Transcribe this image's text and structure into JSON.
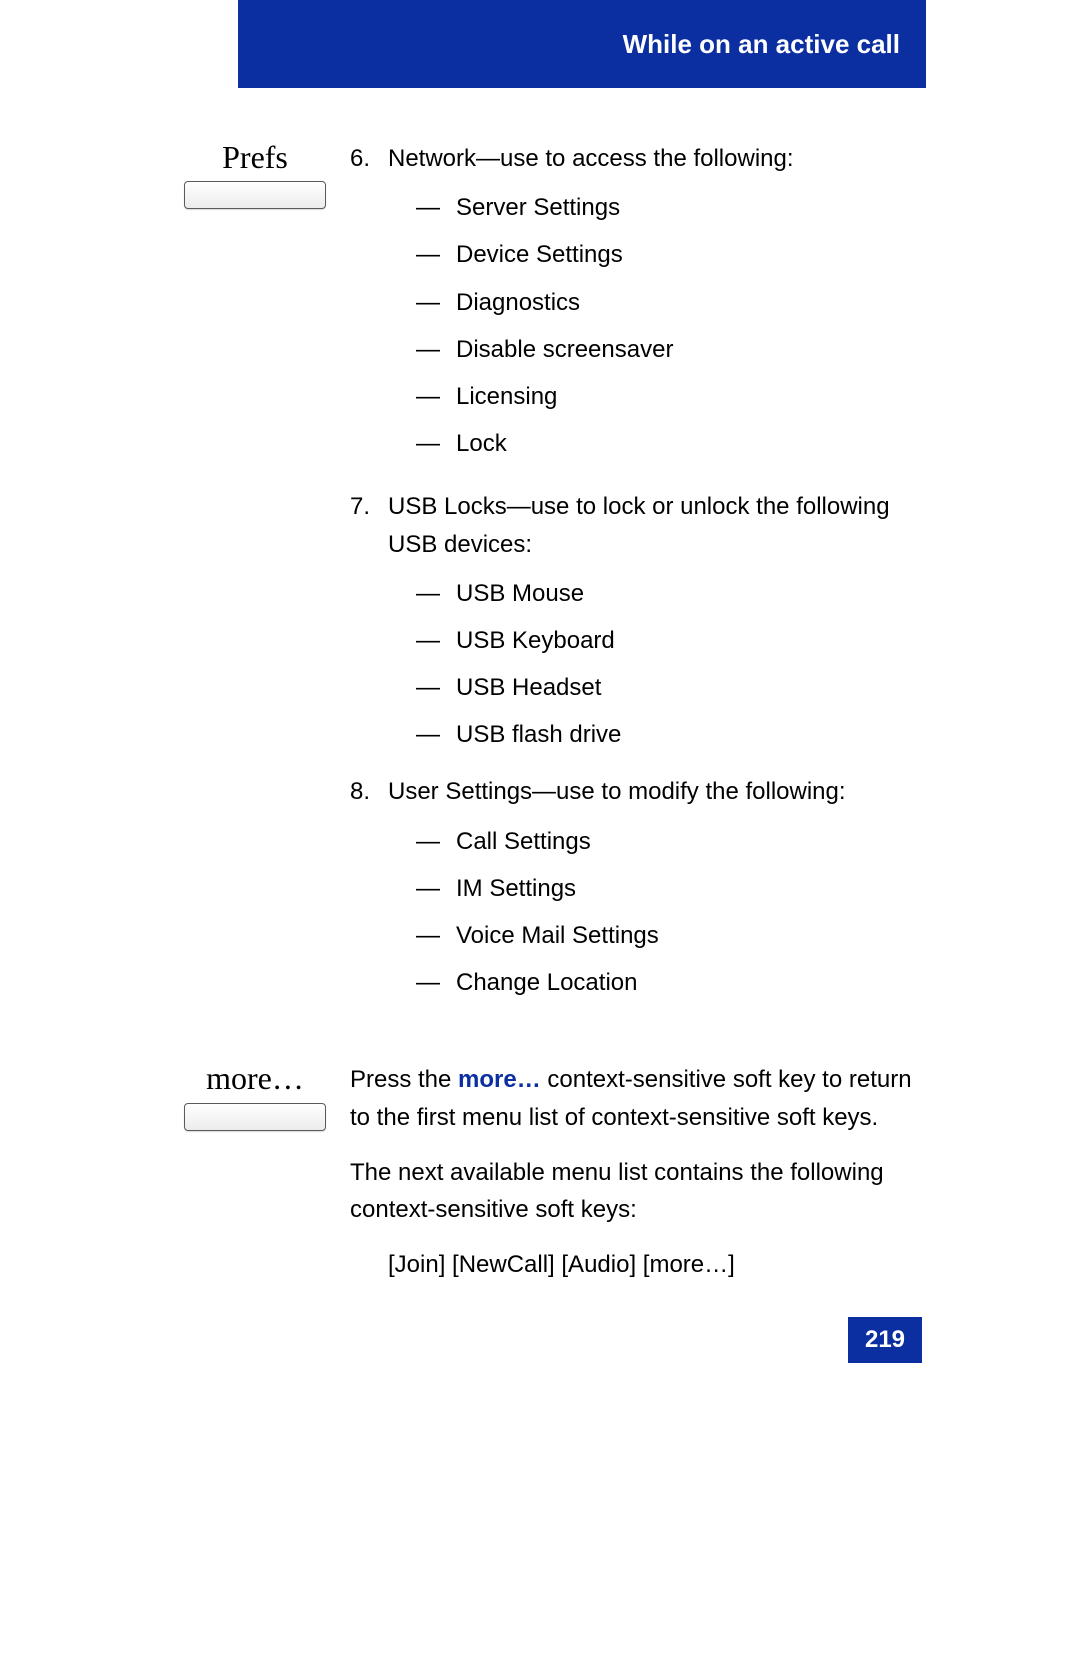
{
  "header": {
    "title": "While on an active call"
  },
  "softkeys": {
    "prefs": "Prefs",
    "more": "more…"
  },
  "item6": {
    "num": "6.",
    "text": "Network—use to access the following:",
    "sub": [
      "Server Settings",
      "Device Settings",
      "Diagnostics",
      "Disable screensaver",
      "Licensing",
      "Lock"
    ]
  },
  "item7": {
    "num": "7.",
    "text": "USB Locks—use to lock or unlock the following USB devices:",
    "sub": [
      "USB Mouse",
      "USB Keyboard",
      "USB Headset",
      "USB flash drive"
    ]
  },
  "item8": {
    "num": "8.",
    "text": "User Settings—use to modify the following:",
    "sub": [
      "Call Settings",
      "IM Settings",
      "Voice Mail Settings",
      "Change Location"
    ]
  },
  "moreSection": {
    "para1_prefix": "Press the ",
    "para1_link": "more…",
    "para1_suffix": " context-sensitive soft key to return to the first menu list of context-sensitive soft keys.",
    "para2": "The next available menu list contains the following context-sensitive soft keys:",
    "para3": "[Join] [NewCall] [Audio] [more…]"
  },
  "dash": "—",
  "pageNumber": "219"
}
